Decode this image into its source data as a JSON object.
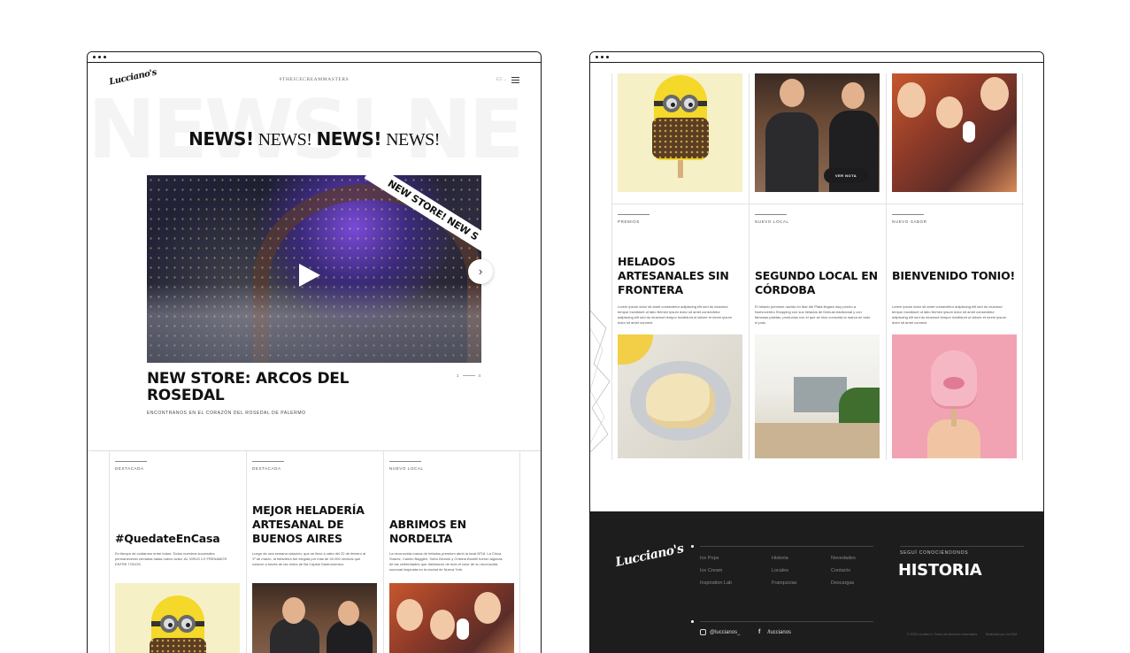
{
  "left": {
    "logo": "Lucciano's",
    "hashtag": "#THEICECREAMMASTERS",
    "lang": "ES ⌄",
    "bg_word": "NEWS! NE",
    "news_bold": "NEWS!",
    "news_light": "NEWS!",
    "hero": {
      "ribbon": "NEW STORE! NEW S",
      "title": "NEW STORE: ARCOS DEL ROSEDAL",
      "subtitle": "ENCONTRANOS EN EL CORAZÓN DEL ROSEDAL DE PALERMO",
      "pager_current": "1",
      "pager_total": "4",
      "next": "›"
    },
    "cards": [
      {
        "category": "DESTACADA",
        "title": "#QuedateEnCasa",
        "body": "En tiempo de cuidarnos entre todos: Todos nuestros sucursales permanecerán cerradas hasta nuevo aviso. AL VIRUS LO FRENAMOS ENTRE TODOS."
      },
      {
        "category": "DESTACADA",
        "title": "MEJOR HELADERÍA ARTESANAL DE BUENOS AIRES",
        "body": "Luego de una semana votación, que se llevó a cabo del 22 de febrero al 1º de marzo, la heladería fue elegida por más de 40.000 vecinos que votaron a través de las redes de Ba Capital Gastronómica."
      },
      {
        "category": "NUEVO LOCAL",
        "title": "ABRIMOS EN NORDELTA",
        "body": "La reconocida marca de helados premium abrió la local Nº16. La Chica Suarez, Camilo Baggieri, Sofía Zámolo y Cristina Bonelli fueron algunas de las celebridades que disfrutaron de todo el color de su reconocida sucursal inspirada en la ciudad de Nueva York."
      }
    ]
  },
  "right": {
    "see_note": "VER NOTA",
    "cards": [
      {
        "category": "PREMIOS",
        "title": "HELADOS ARTESANALES SIN FRONTERA",
        "body": "Lorem ipsum dolor sit amet consectetur adipiscing elit sed do eiusmod tempor incididunt ut labo fermen ipsum dolor sit amet consectetur adipiscing elit sed do eiusmod tempor incididunt ut labore et lorem ipsum dolor sit amet connect."
      },
      {
        "category": "NUEVO LOCAL",
        "title": "SEGUNDO LOCAL EN CÓRDOBA",
        "body": "El helado premium nacido en Mar del Plata llegará muy pronto a Nuevocentro Shopping con sus helados de fórmula tradicional y con famosas paletas, productos con el que se hizo conocida la marca en todo el país."
      },
      {
        "category": "NUEVO SABOR",
        "title": "BIENVENIDO TONIO!",
        "body": "Lorem ipsum dolor sit amet consectetur adipiscing elit sed do eiusmod tempor incididunt ut labo fermen ipsum dolor sit amet consectetur adipiscing elit sed do eiusmod tempor incididunt ut labore et lorem ipsum dolor sit amet connect."
      }
    ],
    "footer": {
      "logo": "Lucciano's",
      "col1": [
        "Ice Pops",
        "Ice Cream",
        "Inspiration Lab"
      ],
      "col2": [
        "Historia",
        "Locales",
        "Franquicias"
      ],
      "col3": [
        "Novedades",
        "Contacto",
        "Descargas"
      ],
      "seguir": "SEGUÍ CONOCIÉNDONOS",
      "historia": "HISTORIA",
      "instagram": "@luccianos_",
      "facebook": "/luccianos",
      "copyright": "© 2020 Lucciano's. Todos los derechos reservados.",
      "credit": "Realizado por LUCIDA"
    }
  }
}
